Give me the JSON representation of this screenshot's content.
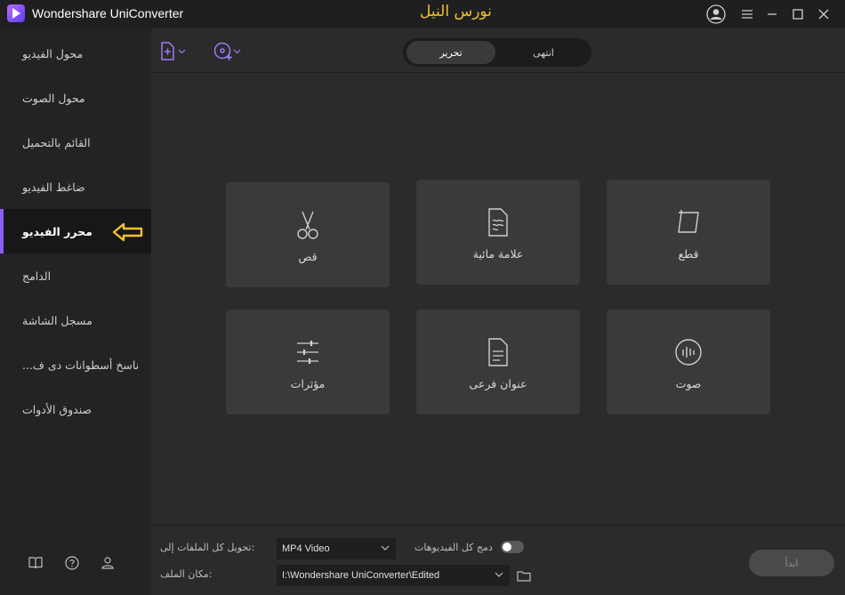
{
  "app": {
    "name": "Wondershare UniConverter",
    "watermark": "نورس النيل"
  },
  "sidebar": {
    "items": [
      {
        "label": "محول الفيديو"
      },
      {
        "label": "محول الصوت"
      },
      {
        "label": "القائم بالتحميل"
      },
      {
        "label": "ضاغط الفيديو"
      },
      {
        "label": "محرر الفيديو",
        "active": true
      },
      {
        "label": "الدامج"
      },
      {
        "label": "مسجل الشاشة"
      },
      {
        "label": "...ناسخ أسطوانات دى ف"
      },
      {
        "label": "صندوق الأدوات"
      }
    ],
    "bottom_icons": [
      "book-icon",
      "help-icon",
      "account-icon"
    ]
  },
  "toolbar": {
    "tabs": [
      {
        "label": "تحرير",
        "active": true
      },
      {
        "label": "انتهى",
        "active": false
      }
    ]
  },
  "tools": [
    {
      "label": "قص",
      "icon": "scissors-icon"
    },
    {
      "label": "علامة مائية",
      "icon": "watermark-icon"
    },
    {
      "label": "قطع",
      "icon": "crop-icon"
    },
    {
      "label": "مؤثرات",
      "icon": "effects-icon"
    },
    {
      "label": "عنوان فرعى",
      "icon": "subtitle-icon"
    },
    {
      "label": "صوت",
      "icon": "audio-icon"
    }
  ],
  "footer": {
    "convert_all_label": "تحويل كل الملفات إلى:",
    "format_value": "MP4 Video",
    "merge_label": "دمج كل الفيديوهات",
    "merge_enabled": false,
    "location_label": "مكان الملف:",
    "location_value": "I:\\Wondershare UniConverter\\Edited",
    "start_label": "ابدأ"
  },
  "colors": {
    "accent": "#8b5cf6",
    "annotation": "#f2c12e",
    "tile": "#3a3a3a"
  }
}
